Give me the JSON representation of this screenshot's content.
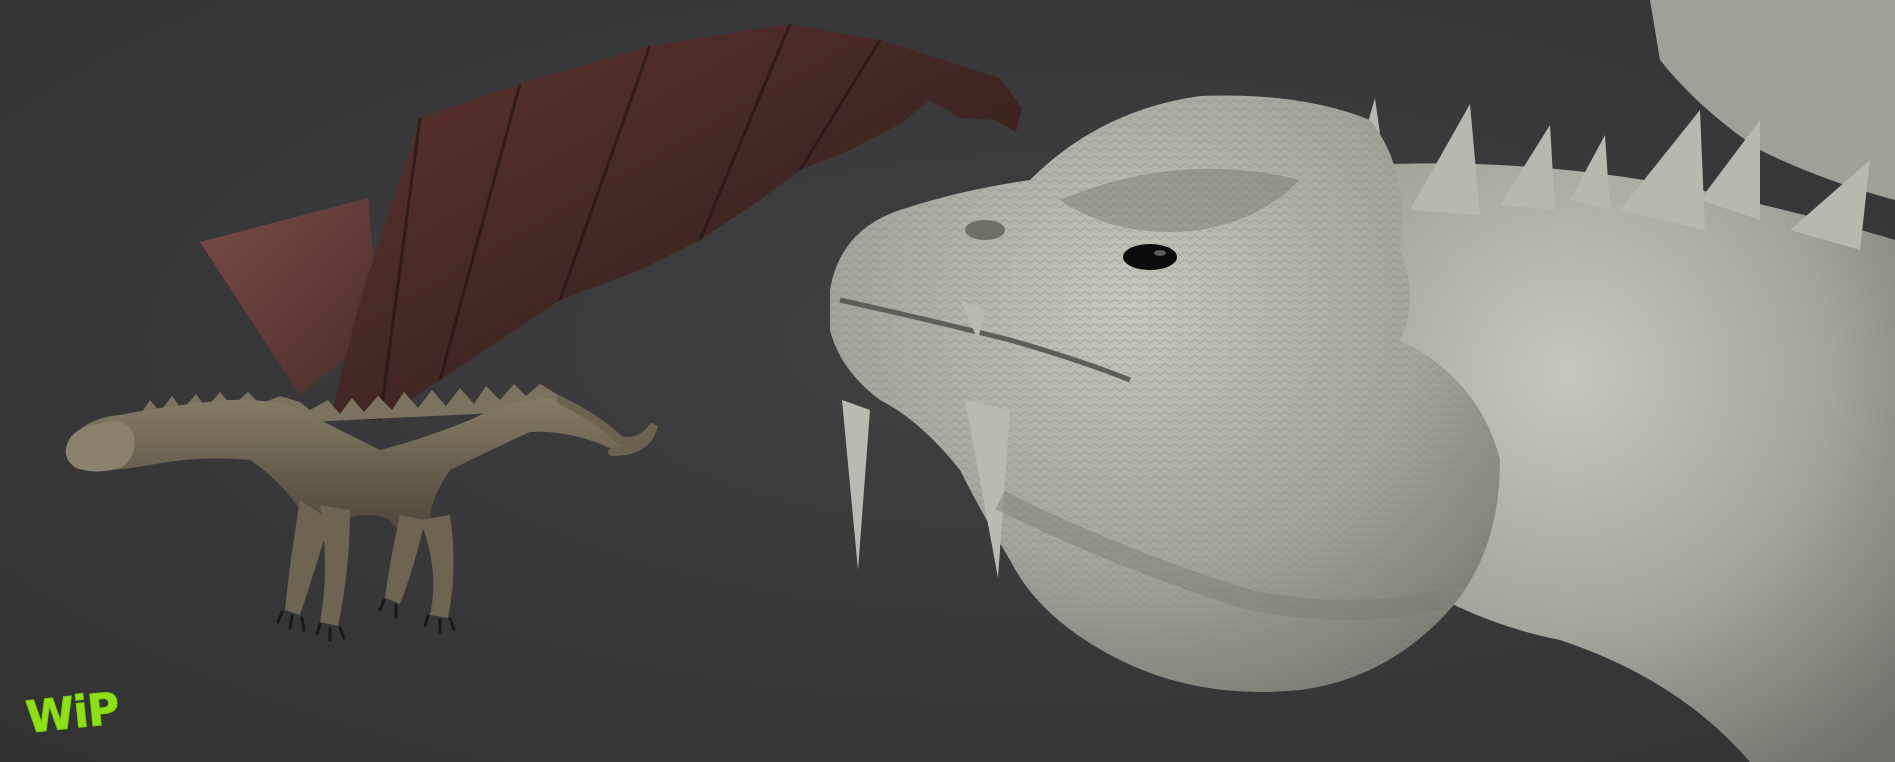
{
  "artwork": {
    "watermark_text": "WiP",
    "subjects": [
      "flying-dragon-render",
      "dragon-head-sculpt"
    ]
  },
  "colors": {
    "background": "#3a3a3b",
    "watermark": "#8ee019",
    "wing_membrane": "#4a2a24",
    "wing_membrane_back": "#6e4440",
    "dragon_body": "#6b6350",
    "sculpt_clay": "#a5a79e"
  }
}
